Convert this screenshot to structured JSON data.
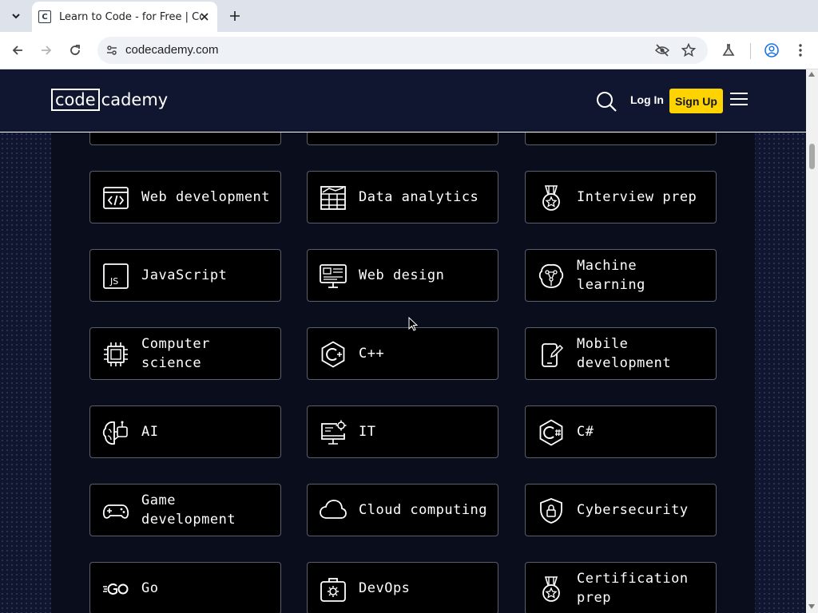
{
  "browser": {
    "tab_title": "Learn to Code - for Free | Codecademy",
    "tab_favicon": "C",
    "url": "codecademy.com"
  },
  "header": {
    "logo_box": "code",
    "logo_rest": "cademy",
    "login_label": "Log In",
    "signup_label": "Sign Up"
  },
  "colors": {
    "page_bg": "#10162f",
    "card_bg": "#000000",
    "signup_yellow": "#ffd300"
  },
  "topics": [
    {
      "label": "Web development",
      "icon": "code-window-icon"
    },
    {
      "label": "Data analytics",
      "icon": "data-table-icon"
    },
    {
      "label": "Interview prep",
      "icon": "medal-icon"
    },
    {
      "label": "JavaScript",
      "icon": "js-icon"
    },
    {
      "label": "Web design",
      "icon": "monitor-design-icon"
    },
    {
      "label": "Machine learning",
      "icon": "brain-network-icon"
    },
    {
      "label": "Computer science",
      "icon": "cpu-chip-icon"
    },
    {
      "label": "C++",
      "icon": "cpp-icon"
    },
    {
      "label": "Mobile development",
      "icon": "mobile-phone-icon"
    },
    {
      "label": "AI",
      "icon": "ai-brain-icon"
    },
    {
      "label": "IT",
      "icon": "monitor-gear-icon"
    },
    {
      "label": "C#",
      "icon": "csharp-icon"
    },
    {
      "label": "Game development",
      "icon": "gamepad-icon"
    },
    {
      "label": "Cloud computing",
      "icon": "cloud-icon"
    },
    {
      "label": "Cybersecurity",
      "icon": "shield-lock-icon"
    },
    {
      "label": "Go",
      "icon": "go-icon"
    },
    {
      "label": "DevOps",
      "icon": "toolbox-gear-icon"
    },
    {
      "label": "Certification prep",
      "icon": "certificate-medal-icon"
    }
  ]
}
